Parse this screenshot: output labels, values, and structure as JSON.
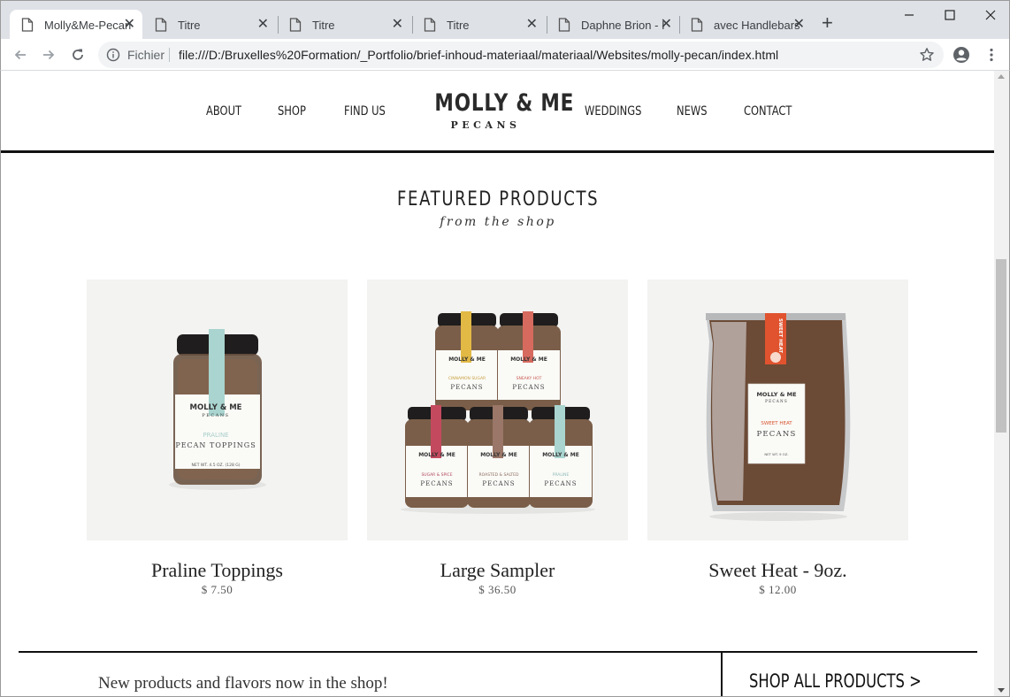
{
  "browser": {
    "tabs": [
      {
        "title": "Molly&Me-Pecan",
        "active": true
      },
      {
        "title": "Titre",
        "active": false
      },
      {
        "title": "Titre",
        "active": false
      },
      {
        "title": "Titre",
        "active": false
      },
      {
        "title": "Daphne Brion - I",
        "active": false
      },
      {
        "title": "avec Handlebars",
        "active": false
      }
    ],
    "new_tab": "+",
    "address": {
      "scheme_label": "Fichier",
      "url": "file:///D:/Bruxelles%20Formation/_Portfolio/brief-inhoud-materiaal/materiaal/Websites/molly-pecan/index.html"
    }
  },
  "site": {
    "nav_left": [
      "ABOUT",
      "SHOP",
      "FIND US"
    ],
    "nav_right": [
      "WEDDINGS",
      "NEWS",
      "CONTACT"
    ],
    "logo": {
      "main": "MOLLY & ME",
      "sub": "PECANS"
    },
    "featured": {
      "title": "FEATURED PRODUCTS",
      "subtitle": "from the shop",
      "products": [
        {
          "name": "Praline Toppings",
          "price": "$ 7.50",
          "label_brand": "MOLLY & ME",
          "label_brand_sub": "PECANS",
          "label_flavor": "PRALINE",
          "label_product": "PECAN TOPPINGS",
          "label_weight": "NET WT. 4.5 OZ. (128 G)",
          "band_color": "#a9d4cf"
        },
        {
          "name": "Large Sampler",
          "price": "$ 36.50",
          "jars": [
            {
              "flavor": "CINNAMON SUGAR",
              "band": "#e2b945"
            },
            {
              "flavor": "SNEAKY HOT",
              "band": "#d76a5f"
            },
            {
              "flavor": "SUGAR & SPICE",
              "band": "#c34a5e"
            },
            {
              "flavor": "ROASTED & SALTED",
              "band": "#9a7768"
            },
            {
              "flavor": "PRALINE",
              "band": "#a9d4cf"
            }
          ],
          "jar_name": "PECANS"
        },
        {
          "name": "Sweet Heat - 9oz.",
          "price": "$ 12.00",
          "label_brand": "MOLLY & ME",
          "label_brand_sub": "PECANS",
          "label_flavor": "SWEET HEAT",
          "label_product": "PECANS",
          "label_weight": "NET WT. 9 OZ.",
          "side_label": "SWEET HEAT",
          "band_color": "#e0532e"
        }
      ]
    },
    "banner": {
      "text": "New products and flavors now in the shop!",
      "cta": "SHOP ALL PRODUCTS >"
    }
  }
}
